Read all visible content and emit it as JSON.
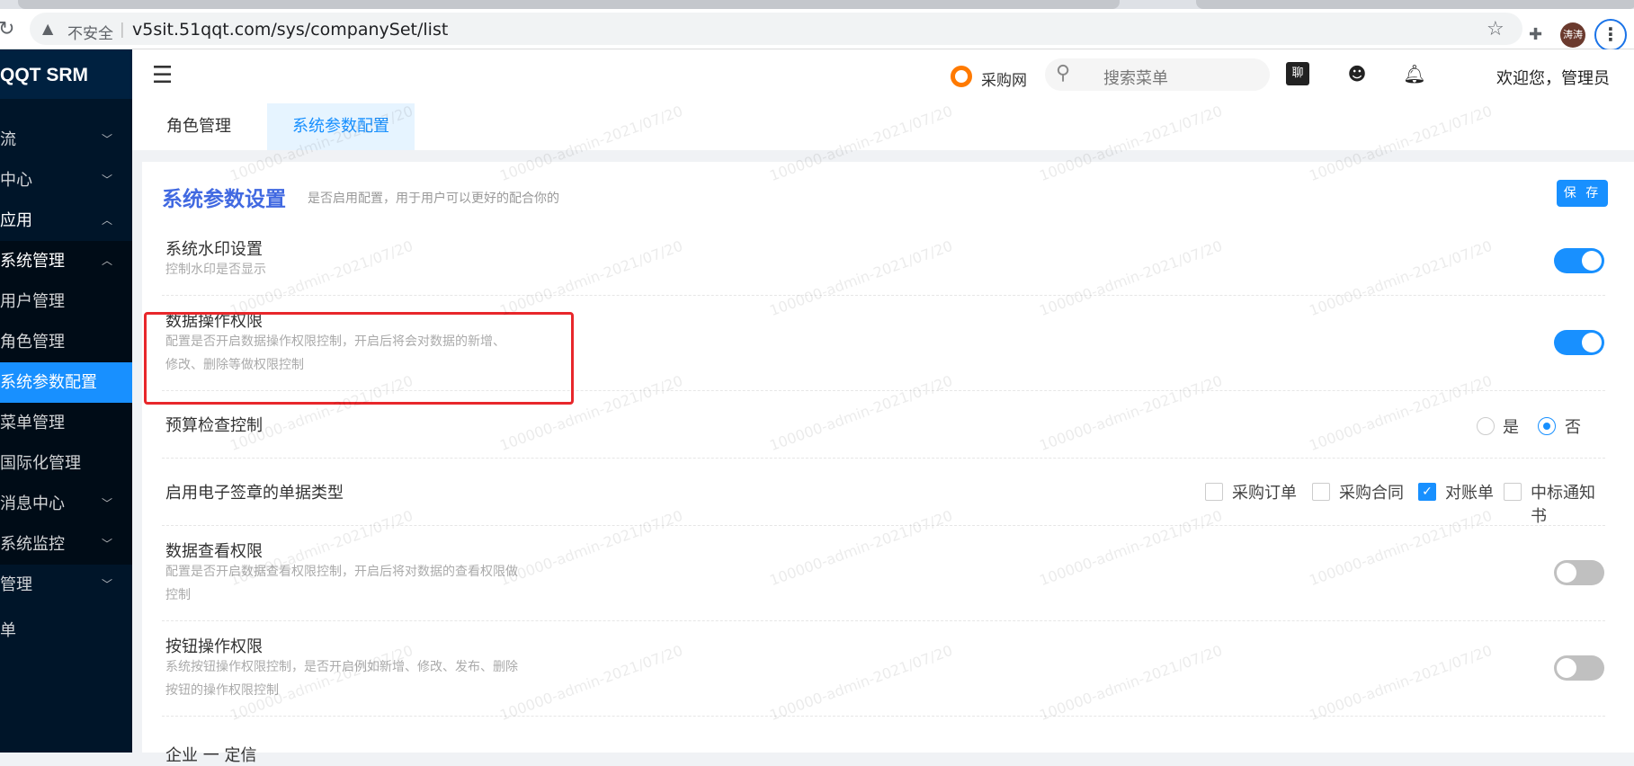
{
  "browser": {
    "insecure_label": "不安全",
    "url": "v5sit.51qqt.com/sys/companySet/list",
    "profile_name": "涛涛"
  },
  "sidebar": {
    "logo": "QQT SRM",
    "items": [
      {
        "label": "流",
        "chevron": "down"
      },
      {
        "label": "中心",
        "chevron": "down"
      },
      {
        "label": "应用",
        "chevron": "up"
      },
      {
        "label": "系统管理",
        "chevron": "up"
      },
      {
        "label": "用户管理"
      },
      {
        "label": "角色管理"
      },
      {
        "label": "系统参数配置",
        "active": true
      },
      {
        "label": "菜单管理"
      },
      {
        "label": "国际化管理"
      },
      {
        "label": "消息中心",
        "chevron": "down"
      },
      {
        "label": "系统监控",
        "chevron": "down"
      },
      {
        "label": "管理",
        "chevron": "down"
      },
      {
        "label": "单"
      }
    ]
  },
  "header": {
    "brand": "采购网",
    "search_placeholder": "搜索菜单",
    "chat_label": "聊",
    "welcome": "欢迎您，管理员"
  },
  "tabs": [
    {
      "label": "角色管理"
    },
    {
      "label": "系统参数配置",
      "active": true
    }
  ],
  "card": {
    "title": "系统参数设置",
    "subtitle": "是否启用配置，用于用户可以更好的配合你的",
    "save_label": "保 存"
  },
  "settings": {
    "watermark": {
      "title": "系统水印设置",
      "desc": "控制水印是否显示",
      "enabled": true
    },
    "data_op": {
      "title": "数据操作权限",
      "desc": "配置是否开启数据操作权限控制，开启后将会对数据的新增、修改、删除等做权限控制",
      "enabled": true
    },
    "budget": {
      "title": "预算检查控制",
      "options": [
        "是",
        "否"
      ],
      "selected": "否"
    },
    "esign": {
      "title": "启用电子签章的单据类型",
      "options": [
        {
          "label": "采购订单",
          "checked": false
        },
        {
          "label": "采购合同",
          "checked": false
        },
        {
          "label": "对账单",
          "checked": true
        },
        {
          "label": "中标通知书",
          "checked": false
        }
      ]
    },
    "data_view": {
      "title": "数据查看权限",
      "desc": "配置是否开启数据查看权限控制，开启后将对数据的查看权限做控制",
      "enabled": false
    },
    "button_op": {
      "title": "按钮操作权限",
      "desc": "系统按钮操作权限控制，是否开启例如新增、修改、发布、删除按钮的操作权限控制",
      "enabled": false
    },
    "next_partial": "企业 一 定信"
  },
  "watermark_text": "100000-admin-2021/07/20",
  "colors": {
    "primary": "#1890ff",
    "sidebar": "#001529",
    "title": "#4169e1",
    "highlight": "#e8272b"
  }
}
